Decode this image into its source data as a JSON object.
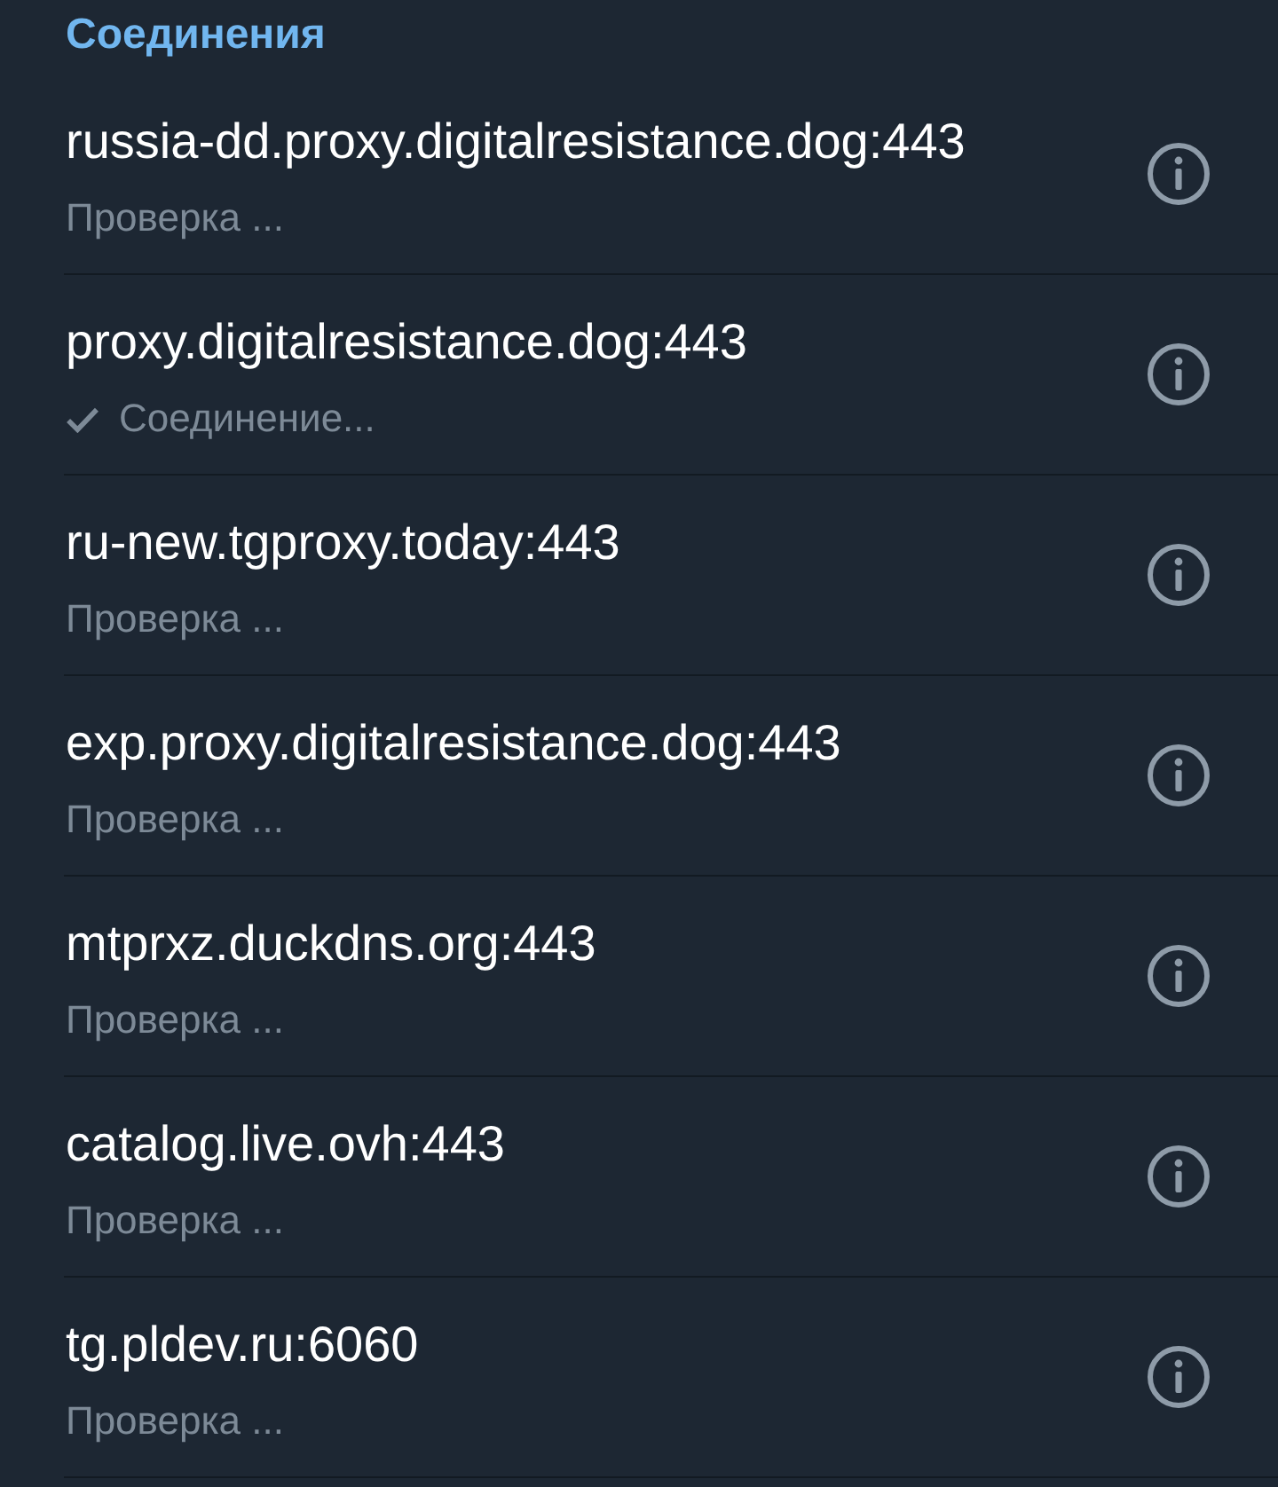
{
  "section": {
    "title": "Соединения"
  },
  "proxies": [
    {
      "address": "russia-dd.proxy.digitalresistance.dog:443",
      "status": "Проверка ...",
      "selected": false
    },
    {
      "address": "proxy.digitalresistance.dog:443",
      "status": "Соединение...",
      "selected": true
    },
    {
      "address": "ru-new.tgproxy.today:443",
      "status": "Проверка ...",
      "selected": false
    },
    {
      "address": "exp.proxy.digitalresistance.dog:443",
      "status": "Проверка ...",
      "selected": false
    },
    {
      "address": "mtprxz.duckdns.org:443",
      "status": "Проверка ...",
      "selected": false
    },
    {
      "address": "catalog.live.ovh:443",
      "status": "Проверка ...",
      "selected": false
    },
    {
      "address": "tg.pldev.ru:6060",
      "status": "Проверка ...",
      "selected": false
    }
  ]
}
